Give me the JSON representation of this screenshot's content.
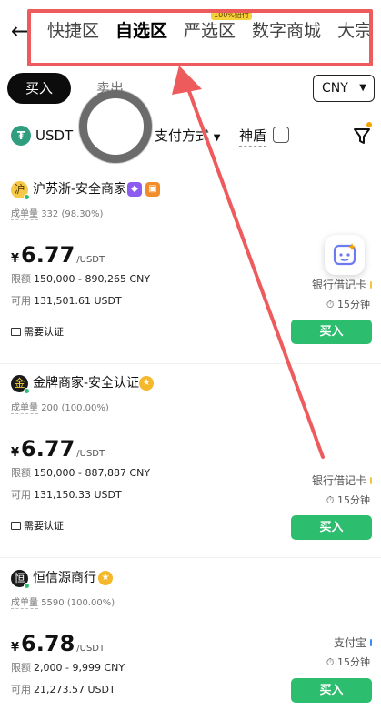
{
  "nav": {
    "back_icon": "arrow-left-icon",
    "tabs": [
      {
        "label": "快捷区",
        "active": false
      },
      {
        "label": "自选区",
        "active": true
      },
      {
        "label": "严选区",
        "active": false,
        "badge": "100%赔付"
      },
      {
        "label": "数字商城",
        "active": false
      },
      {
        "label": "大宗",
        "active": false
      }
    ]
  },
  "trade": {
    "buy_label": "买入",
    "sell_label": "卖出",
    "currency": "CNY"
  },
  "filters": {
    "coin": "USDT",
    "payment": "支付方式",
    "shield": "神盾",
    "filter_icon": "filter-icon"
  },
  "merchants": [
    {
      "avatar_char": "沪",
      "name": "沪苏浙-安全商家",
      "stats_label": "成单量",
      "stats_value": "332 (98.30%)",
      "currency_symbol": "¥",
      "price": "6.77",
      "unit": "/USDT",
      "limit_label": "限额",
      "limit_value": "150,000 - 890,265 CNY",
      "avail_label": "可用",
      "avail_value": "131,501.61 USDT",
      "verify": "需要认证",
      "payment": "银行借记卡",
      "time": "15分钟",
      "buy": "买入"
    },
    {
      "avatar_char": "金",
      "name": "金牌商家-安全认证",
      "stats_label": "成单量",
      "stats_value": "200 (100.00%)",
      "currency_symbol": "¥",
      "price": "6.77",
      "unit": "/USDT",
      "limit_label": "限额",
      "limit_value": "150,000 - 887,887 CNY",
      "avail_label": "可用",
      "avail_value": "131,150.33 USDT",
      "verify": "需要认证",
      "payment": "银行借记卡",
      "time": "15分钟",
      "buy": "买入"
    },
    {
      "avatar_char": "恒",
      "name": "恒信源商行",
      "stats_label": "成单量",
      "stats_value": "5590 (100.00%)",
      "currency_symbol": "¥",
      "price": "6.78",
      "unit": "/USDT",
      "limit_label": "限额",
      "limit_value": "2,000 - 9,999 CNY",
      "avail_label": "可用",
      "avail_value": "21,273.57 USDT",
      "verify": "",
      "payment": "支付宝",
      "time": "15分钟",
      "buy": "买入"
    }
  ],
  "colors": {
    "buy_green": "#2dbd6e",
    "annotation_red": "#ee5b5d",
    "badge_gold": "#f5d13a"
  }
}
